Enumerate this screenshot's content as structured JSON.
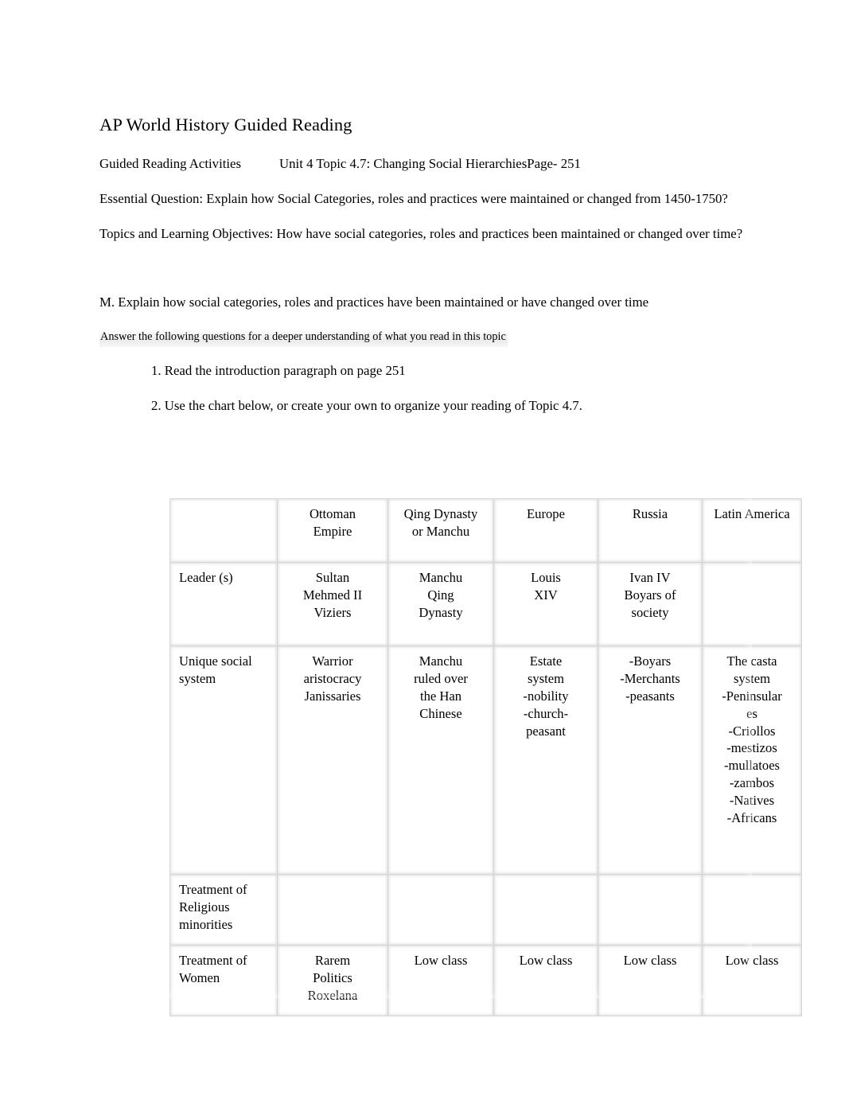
{
  "document": {
    "title": "AP World History Guided Reading",
    "activities_label": "Guided Reading Activities",
    "unit_topic": "Unit 4 Topic 4.7: Changing Social Hierarchies",
    "page_ref": "Page- 251",
    "essential_question": "Essential Question: Explain how Social Categories, roles and practices were maintained or changed from 1450-1750?",
    "topics_objectives": "Topics and Learning Objectives: How have social categories, roles and practices been maintained or changed over time?",
    "objective_m": "M. Explain how social categories, roles and practices have been maintained or have changed over time",
    "answer_instruction": "Answer the following questions for a deeper understanding of what you read in this topic",
    "item_1": "1. Read the introduction paragraph on page 251",
    "item_2": "2.  Use the chart below, or create your own to organize your reading of Topic 4.7."
  },
  "chart_data": {
    "type": "table",
    "title": "",
    "columns": [
      "",
      "Ottoman Empire",
      "Qing Dynasty or Manchu",
      "Europe",
      "Russia",
      "Latin America"
    ],
    "column_lines": [
      [
        ""
      ],
      [
        "Ottoman",
        "Empire"
      ],
      [
        "Qing Dynasty",
        "or Manchu"
      ],
      [
        "Europe"
      ],
      [
        "Russia"
      ],
      [
        "Latin America"
      ]
    ],
    "rows": [
      {
        "label": "Leader (s)",
        "label_lines": [
          "Leader (s)"
        ],
        "cells": [
          [
            "Sultan",
            "Mehmed II",
            "Viziers"
          ],
          [
            "Manchu",
            "Qing",
            "Dynasty"
          ],
          [
            "Louis",
            "XIV"
          ],
          [
            "Ivan IV",
            "Boyars of",
            "society"
          ],
          [
            ""
          ]
        ]
      },
      {
        "label": "Unique social system",
        "label_lines": [
          "Unique social",
          "system"
        ],
        "cells": [
          [
            "Warrior",
            "aristocracy",
            "Janissaries"
          ],
          [
            "Manchu",
            "ruled over",
            "the Han",
            "Chinese"
          ],
          [
            "Estate",
            "system",
            "-nobility",
            "-church-",
            "peasant"
          ],
          [
            "-Boyars",
            "-Merchants",
            "-peasants"
          ],
          [
            "The casta",
            "system",
            "-Peninsular",
            "es",
            "-Criollos",
            "-mestizos",
            "-mullatoes",
            "-zambos",
            "-Natives",
            "-Africans"
          ]
        ]
      },
      {
        "label": "Treatment of Religious minorities",
        "label_lines": [
          "Treatment of",
          "Religious",
          "minorities"
        ],
        "cells": [
          [
            ""
          ],
          [
            ""
          ],
          [
            ""
          ],
          [
            ""
          ],
          [
            ""
          ]
        ]
      },
      {
        "label": "Treatment of Women",
        "label_lines": [
          "Treatment of",
          "Women"
        ],
        "cells": [
          [
            "Rarem",
            "Politics",
            "Roxelana"
          ],
          [
            "Low class"
          ],
          [
            "Low class"
          ],
          [
            "Low class"
          ],
          [
            "Low class"
          ]
        ]
      }
    ]
  }
}
